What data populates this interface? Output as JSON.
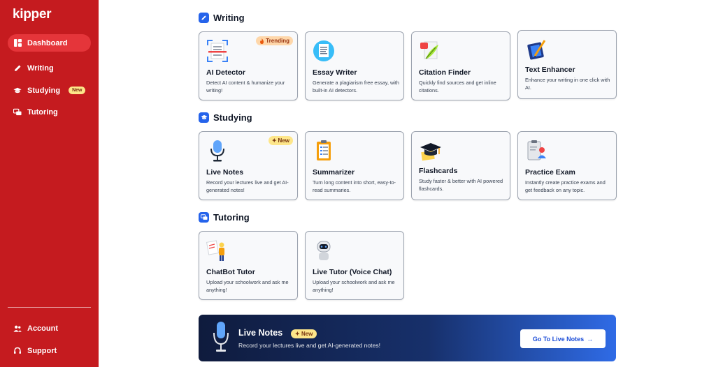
{
  "brand": {
    "name": "kipper"
  },
  "sidebar": {
    "items": [
      {
        "label": "Dashboard",
        "icon": "grid-icon",
        "active": true
      },
      {
        "label": "Writing",
        "icon": "pencil-icon"
      },
      {
        "label": "Studying",
        "icon": "graduation-cap-icon",
        "badge": "New"
      },
      {
        "label": "Tutoring",
        "icon": "chat-bubbles-icon"
      }
    ],
    "bottom": [
      {
        "label": "Account",
        "icon": "users-icon"
      },
      {
        "label": "Support",
        "icon": "headset-icon"
      }
    ]
  },
  "sections": {
    "writing": {
      "title": "Writing",
      "cards": [
        {
          "title": "AI Detector",
          "desc": "Detect AI content & humanize your writing!",
          "badge": "Trending"
        },
        {
          "title": "Essay Writer",
          "desc": "Generate a plagiarism free essay, with built-in AI detectors."
        },
        {
          "title": "Citation Finder",
          "desc": "Quickly find sources and get inline citations."
        },
        {
          "title": "Text Enhancer",
          "desc": "Enhance your writing in one click with AI."
        }
      ]
    },
    "studying": {
      "title": "Studying",
      "cards": [
        {
          "title": "Live Notes",
          "desc": "Record your lectures live and get AI-generated notes!",
          "badge": "New"
        },
        {
          "title": "Summarizer",
          "desc": "Turn long content into short, easy-to-read summaries."
        },
        {
          "title": "Flashcards",
          "desc": "Study faster & better with AI powered flashcards."
        },
        {
          "title": "Practice Exam",
          "desc": "Instantly create practice exams and get feedback on any topic."
        }
      ]
    },
    "tutoring": {
      "title": "Tutoring",
      "cards": [
        {
          "title": "ChatBot Tutor",
          "desc": "Upload your schoolwork and ask me anything!"
        },
        {
          "title": "Live Tutor (Voice Chat)",
          "desc": "Upload your schoolwork and ask me anything!"
        }
      ]
    }
  },
  "banner": {
    "title": "Live Notes",
    "badge": "New",
    "subtitle": "Record your lectures live and get AI-generated notes!",
    "button": "Go To Live Notes"
  },
  "colors": {
    "sidebar": "#c51b1f",
    "active": "#e5353a",
    "accent": "#2563eb"
  }
}
